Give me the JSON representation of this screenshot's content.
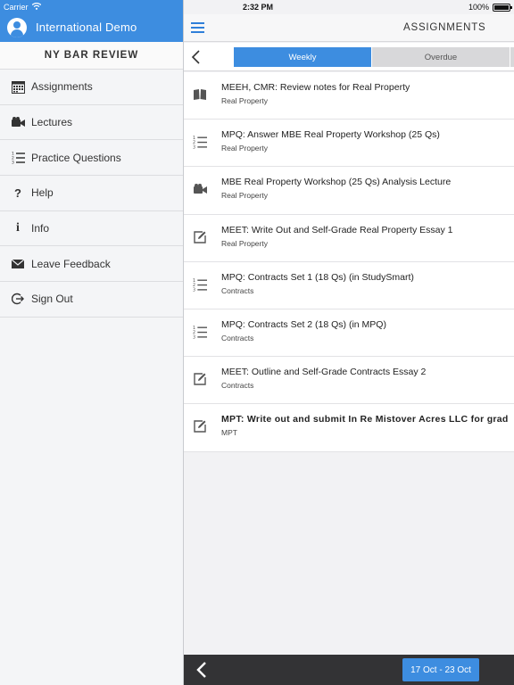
{
  "status_bar": {
    "carrier": "Carrier",
    "time": "2:32 PM",
    "battery": "100%"
  },
  "sidebar": {
    "user_name": "International Demo",
    "course_title": "NY BAR REVIEW",
    "items": [
      {
        "label": "Assignments",
        "icon": "calendar-icon"
      },
      {
        "label": "Lectures",
        "icon": "video-camera-icon"
      },
      {
        "label": "Practice Questions",
        "icon": "numbered-list-icon"
      },
      {
        "label": "Help",
        "icon": "question-mark-icon"
      },
      {
        "label": "Info",
        "icon": "info-icon"
      },
      {
        "label": "Leave Feedback",
        "icon": "envelope-icon"
      },
      {
        "label": "Sign Out",
        "icon": "sign-out-icon"
      }
    ]
  },
  "header": {
    "title": "ASSIGNMENTS"
  },
  "tabs": [
    {
      "label": "Weekly",
      "active": true
    },
    {
      "label": "Overdue",
      "active": false
    }
  ],
  "assignments": [
    {
      "title": "MEEH, CMR: Review notes for Real Property",
      "subject": "Real Property",
      "icon": "book-icon",
      "bold": false
    },
    {
      "title": "MPQ: Answer MBE Real Property Workshop (25 Qs)",
      "subject": "Real Property",
      "icon": "numbered-list-icon",
      "bold": false
    },
    {
      "title": "MBE Real Property Workshop (25 Qs) Analysis Lecture",
      "subject": "Real Property",
      "icon": "video-camera-icon",
      "bold": false
    },
    {
      "title": "MEET: Write Out and Self-Grade Real Property Essay 1",
      "subject": "Real Property",
      "icon": "edit-icon",
      "bold": false
    },
    {
      "title": "MPQ: Contracts Set 1 (18 Qs) (in StudySmart)",
      "subject": "Contracts",
      "icon": "numbered-list-icon",
      "bold": false
    },
    {
      "title": "MPQ: Contracts Set 2 (18 Qs) (in MPQ)",
      "subject": "Contracts",
      "icon": "numbered-list-icon",
      "bold": false
    },
    {
      "title": "MEET: Outline and Self-Grade Contracts Essay 2",
      "subject": "Contracts",
      "icon": "edit-icon",
      "bold": false
    },
    {
      "title": "MPT: Write out and submit In Re Mistover Acres LLC for grad",
      "subject": "MPT",
      "icon": "edit-icon",
      "bold": true
    }
  ],
  "footer": {
    "date_range": "17 Oct - 23 Oct"
  },
  "colors": {
    "accent": "#3d8de0",
    "footer_bg": "#333335",
    "tab_inactive": "#d8d8da"
  }
}
